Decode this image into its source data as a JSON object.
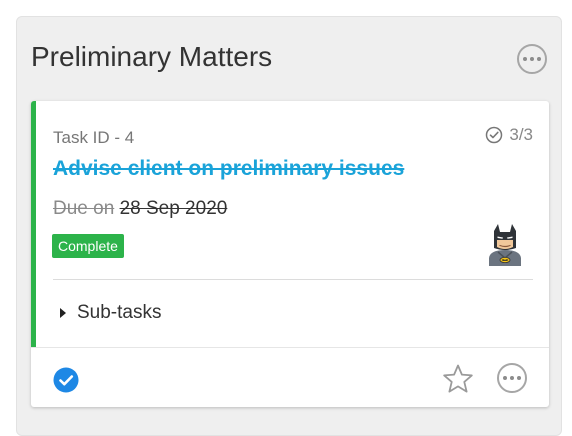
{
  "column": {
    "title": "Preliminary Matters",
    "more_icon": "more-horizontal-circle-icon"
  },
  "card": {
    "task_id": "Task ID - 4",
    "subtasks_count": "3/3",
    "subtasks_icon": "check-circle-outline-icon",
    "title": "Advise client on preliminary issues",
    "due_label": "Due on",
    "due_date": "28 Sep 2020",
    "status": "Complete",
    "avatar_icon": "batman-avatar-icon",
    "subtasks_label": "Sub-tasks",
    "subtasks_toggle_icon": "caret-right-icon",
    "footer": {
      "complete_icon": "check-circle-filled-icon",
      "star_icon": "star-outline-icon",
      "more_icon": "more-horizontal-circle-icon"
    }
  },
  "colors": {
    "accent_green": "#2cb34a",
    "title_link": "#1aa3d9",
    "check_blue": "#1e88e5",
    "column_bg": "#efefef"
  }
}
